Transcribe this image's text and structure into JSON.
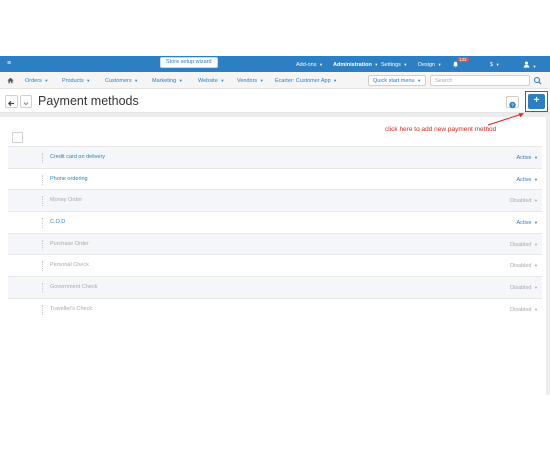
{
  "topbar": {
    "menu_icon": "hamburger-icon",
    "wizard_label": "Store setup wizard",
    "addons": "Add-ons",
    "administration": "Administration",
    "settings": "Settings",
    "design": "Design",
    "notifications_count": "133",
    "currency": "$",
    "user_icon": "user-icon",
    "bg_color": "#2b7fc2"
  },
  "menu": {
    "home_icon": "home-icon",
    "items": [
      "Orders",
      "Products",
      "Customers",
      "Marketing",
      "Website",
      "Vendors",
      "Ecarter: Customer App"
    ],
    "quick_start": "Quick start menu",
    "search_placeholder": "Search",
    "search_icon": "search-icon"
  },
  "titlebar": {
    "title": "Payment methods",
    "help_icon": "help-icon",
    "add_label": "+"
  },
  "annotation": {
    "text": "click here to add new payment method",
    "color": "#e5231b"
  },
  "payment_methods": [
    {
      "name": "Credit card on delivery",
      "status": "Active"
    },
    {
      "name": "Phone ordering",
      "status": "Active"
    },
    {
      "name": "Money Order",
      "status": "Disabled"
    },
    {
      "name": "C.O.D",
      "status": "Active"
    },
    {
      "name": "Purchase Order",
      "status": "Disabled"
    },
    {
      "name": "Personal Check",
      "status": "Disabled"
    },
    {
      "name": "Government Check",
      "status": "Disabled"
    },
    {
      "name": "Traveller's Check",
      "status": "Disabled"
    }
  ]
}
